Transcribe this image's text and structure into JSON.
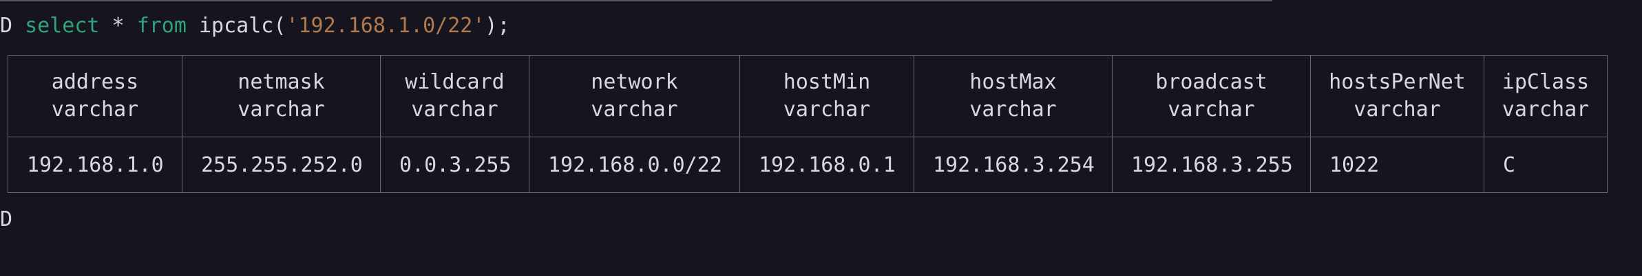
{
  "terminal": {
    "prompt_marker": "D",
    "query": {
      "keyword_select": "select",
      "star": " * ",
      "keyword_from": "from",
      "func_open": " ipcalc(",
      "arg": "'192.168.1.0/22'",
      "func_close": ");"
    },
    "end_prompt_marker": "D"
  },
  "table": {
    "columns": [
      {
        "name": "address",
        "type": "varchar"
      },
      {
        "name": "netmask",
        "type": "varchar"
      },
      {
        "name": "wildcard",
        "type": "varchar"
      },
      {
        "name": "network",
        "type": "varchar"
      },
      {
        "name": "hostMin",
        "type": "varchar"
      },
      {
        "name": "hostMax",
        "type": "varchar"
      },
      {
        "name": "broadcast",
        "type": "varchar"
      },
      {
        "name": "hostsPerNet",
        "type": "varchar"
      },
      {
        "name": "ipClass",
        "type": "varchar"
      }
    ],
    "rows": [
      [
        "192.168.1.0",
        "255.255.252.0",
        "0.0.3.255",
        "192.168.0.0/22",
        "192.168.0.1",
        "192.168.3.254",
        "192.168.3.255",
        "1022",
        "C"
      ]
    ]
  },
  "colors": {
    "background": "#16151f",
    "text": "#d9d8e2",
    "keyword": "#2fa37a",
    "string": "#b07a4c",
    "border": "#6a6875"
  }
}
